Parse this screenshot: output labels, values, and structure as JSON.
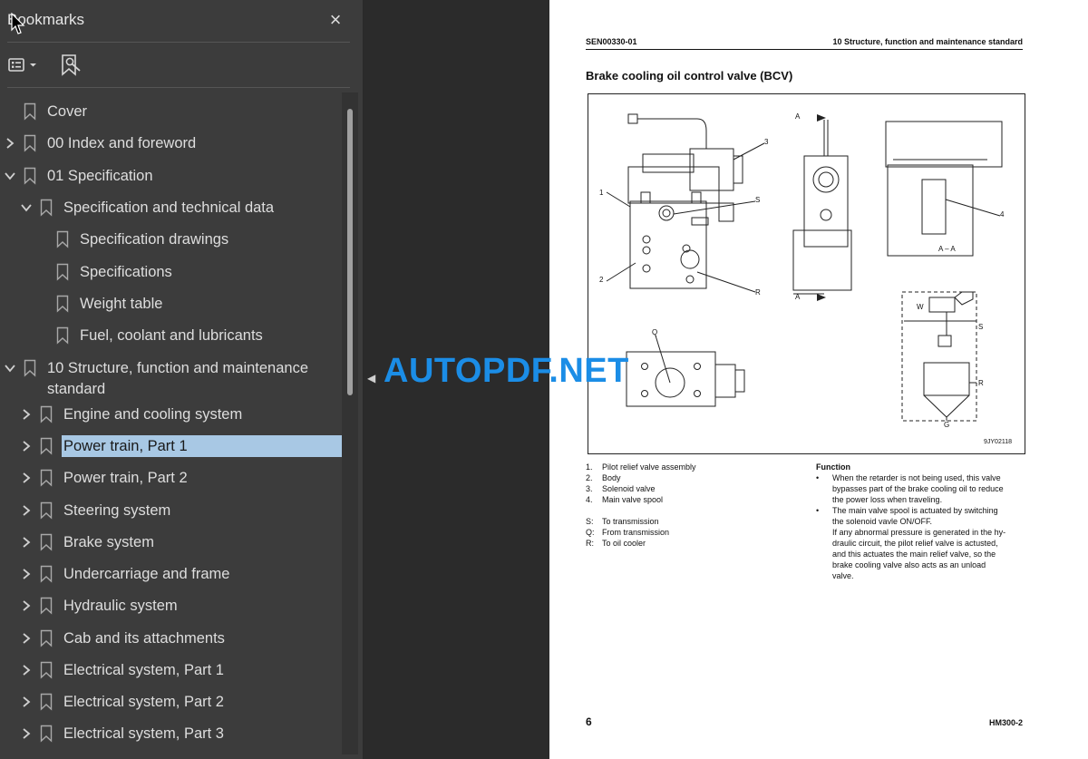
{
  "panel": {
    "title": "Bookmarks",
    "close_icon": "×"
  },
  "bookmarks": [
    {
      "label": "Cover",
      "level": 0,
      "expander": "none"
    },
    {
      "label": "00 Index and foreword",
      "level": 0,
      "expander": "collapsed"
    },
    {
      "label": "01 Specification",
      "level": 0,
      "expander": "expanded"
    },
    {
      "label": "Specification and technical data",
      "level": 1,
      "expander": "expanded"
    },
    {
      "label": "Specification drawings",
      "level": 2,
      "expander": "none"
    },
    {
      "label": "Specifications",
      "level": 2,
      "expander": "none"
    },
    {
      "label": "Weight table",
      "level": 2,
      "expander": "none"
    },
    {
      "label": "Fuel, coolant and lubricants",
      "level": 2,
      "expander": "none"
    },
    {
      "label": "10 Structure, function and maintenance",
      "label2": "standard",
      "level": 0,
      "expander": "expanded"
    },
    {
      "label": "Engine and cooling system",
      "level": 1,
      "expander": "collapsed"
    },
    {
      "label": "Power train, Part 1",
      "level": 1,
      "expander": "collapsed",
      "selected": true
    },
    {
      "label": "Power train, Part 2",
      "level": 1,
      "expander": "collapsed"
    },
    {
      "label": "Steering system",
      "level": 1,
      "expander": "collapsed"
    },
    {
      "label": "Brake system",
      "level": 1,
      "expander": "collapsed"
    },
    {
      "label": "Undercarriage and frame",
      "level": 1,
      "expander": "collapsed"
    },
    {
      "label": "Hydraulic system",
      "level": 1,
      "expander": "collapsed"
    },
    {
      "label": "Cab and its attachments",
      "level": 1,
      "expander": "collapsed"
    },
    {
      "label": "Electrical system, Part 1",
      "level": 1,
      "expander": "collapsed"
    },
    {
      "label": "Electrical system, Part 2",
      "level": 1,
      "expander": "collapsed"
    },
    {
      "label": "Electrical system, Part 3",
      "level": 1,
      "expander": "collapsed"
    }
  ],
  "page": {
    "doc_code": "SEN00330-01",
    "section": "10 Structure, function and maintenance standard",
    "heading": "Brake cooling oil control valve (BCV)",
    "figure_id": "9JY02118",
    "callouts": {
      "n1": "1",
      "n2": "2",
      "n3": "3",
      "n4": "4",
      "s": "S",
      "r": "R",
      "q": "Q",
      "g": "G",
      "a_top": "A",
      "a_bot": "A",
      "aa": "A – A",
      "w": "W",
      "cs": "S",
      "cr": "R",
      "cg": "G"
    },
    "legend_numbered": [
      {
        "k": "1.",
        "v": "Pilot relief valve assembly"
      },
      {
        "k": "2.",
        "v": "Body"
      },
      {
        "k": "3.",
        "v": "Solenoid valve"
      },
      {
        "k": "4.",
        "v": "Main valve spool"
      }
    ],
    "legend_ports": [
      {
        "k": "S:",
        "v": "To transmission"
      },
      {
        "k": "Q:",
        "v": "From transmission"
      },
      {
        "k": "R:",
        "v": "To oil cooler"
      }
    ],
    "function_title": "Function",
    "function_lines": [
      "When the retarder is not being used, this valve",
      "bypasses part of the brake cooling oil to reduce",
      "the power loss when traveling.",
      "The main valve spool is actuated by switching",
      "the solenoid vavle ON/OFF.",
      "If any abnormal pressure is generated in the hy-",
      "draulic circuit, the pilot relief valve is actusted,",
      "and this actuates the main relief valve, so the",
      "brake cooling valve also acts as an unload",
      "valve."
    ],
    "page_number": "6",
    "model": "HM300-2"
  },
  "watermark": "AUTOPDF.NET",
  "colors": {
    "panel_bg": "#3c3c3c",
    "selection": "#a8c8e4",
    "watermark": "#1b8de6"
  }
}
